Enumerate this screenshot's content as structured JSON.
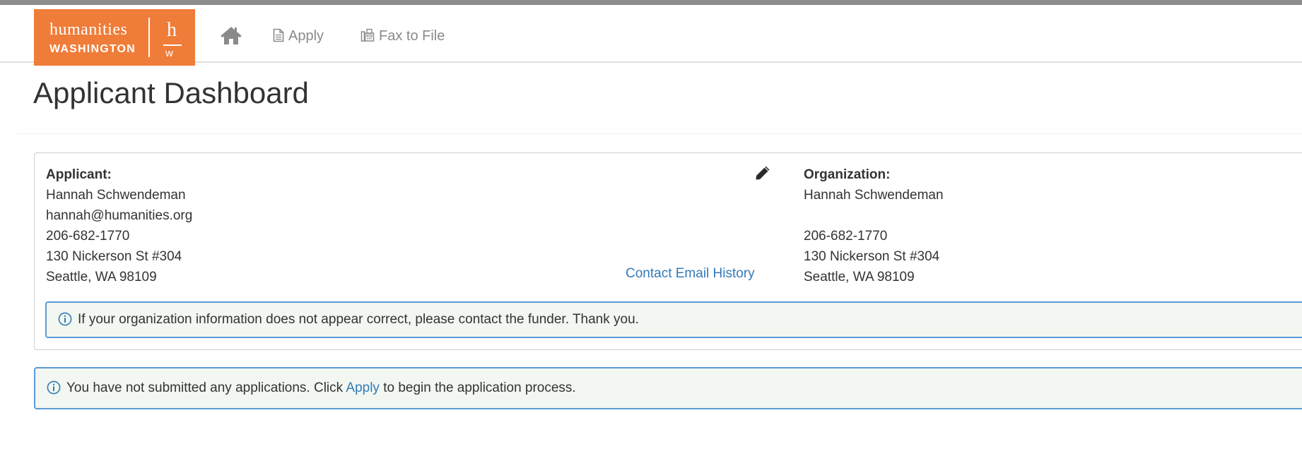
{
  "brand": {
    "logo_line1": "humanities",
    "logo_line2": "WASHINGTON",
    "logo_mark_top": "h",
    "logo_mark_bottom": "w",
    "accent_color": "#ef7c38",
    "link_color": "#337ab7"
  },
  "nav": {
    "home_icon": "home-icon",
    "apply_label": "Apply",
    "apply_icon": "document-icon",
    "fax_label": "Fax to File",
    "fax_icon": "fax-icon"
  },
  "page": {
    "title": "Applicant Dashboard"
  },
  "applicant": {
    "label": "Applicant:",
    "name": "Hannah Schwendeman",
    "email": "hannah@humanities.org",
    "phone": "206-682-1770",
    "address1": "130 Nickerson St #304",
    "address2": "Seattle, WA 98109",
    "edit_icon": "pencil-icon",
    "email_history_link": "Contact Email History"
  },
  "organization": {
    "label": "Organization:",
    "name": "Hannah Schwendeman",
    "phone": "206-682-1770",
    "address1": "130 Nickerson St #304",
    "address2": "Seattle, WA 98109"
  },
  "alerts": {
    "org_info": "If your organization information does not appear correct, please contact the funder. Thank you.",
    "no_apps_prefix": "You have not submitted any applications. Click",
    "no_apps_link": "Apply",
    "no_apps_suffix": "to begin the application process."
  }
}
